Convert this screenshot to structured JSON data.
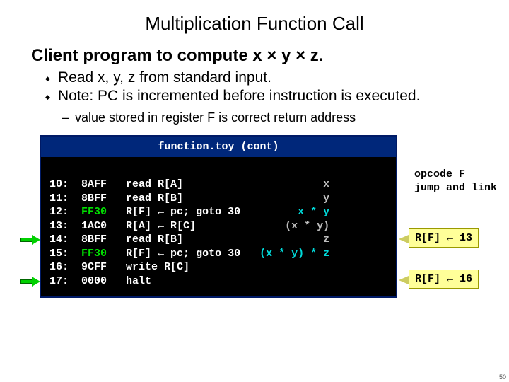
{
  "title": "Multiplication Function Call",
  "subtitle": "Client program to compute x × y × z.",
  "bullets": [
    "Read x, y, z from standard input.",
    "Note:  PC is incremented before instruction is executed."
  ],
  "subnote": "value stored in register F is correct return address",
  "opcode_annotation": {
    "line1": "opcode F",
    "line2": "jump and link"
  },
  "callouts": [
    {
      "text": "R[F] ← 13"
    },
    {
      "text": "R[F] ← 16"
    }
  ],
  "code": {
    "header": "function.toy  (cont)",
    "rows": [
      {
        "addr": "10:",
        "hex": "8AFF",
        "instr": "read R[A]",
        "note": "x",
        "hl_hex": false,
        "hl_note": false
      },
      {
        "addr": "11:",
        "hex": "8BFF",
        "instr": "read R[B]",
        "note": "y",
        "hl_hex": false,
        "hl_note": false
      },
      {
        "addr": "12:",
        "hex": "FF30",
        "instr": "R[F] ← pc; goto 30",
        "note": "x * y",
        "hl_hex": true,
        "hl_note": true
      },
      {
        "addr": "13:",
        "hex": "1AC0",
        "instr": "R[A] ← R[C]",
        "note": "(x * y)",
        "hl_hex": false,
        "hl_note": false
      },
      {
        "addr": "14:",
        "hex": "8BFF",
        "instr": "read R[B]",
        "note": "z",
        "hl_hex": false,
        "hl_note": false
      },
      {
        "addr": "15:",
        "hex": "FF30",
        "instr": "R[F] ← pc; goto 30",
        "note": "(x * y) * z",
        "hl_hex": true,
        "hl_note": true
      },
      {
        "addr": "16:",
        "hex": "9CFF",
        "instr": "write R[C]",
        "note": "",
        "hl_hex": false,
        "hl_note": false
      },
      {
        "addr": "17:",
        "hex": "0000",
        "instr": "halt",
        "note": "",
        "hl_hex": false,
        "hl_note": false
      }
    ]
  },
  "page_number": "50"
}
